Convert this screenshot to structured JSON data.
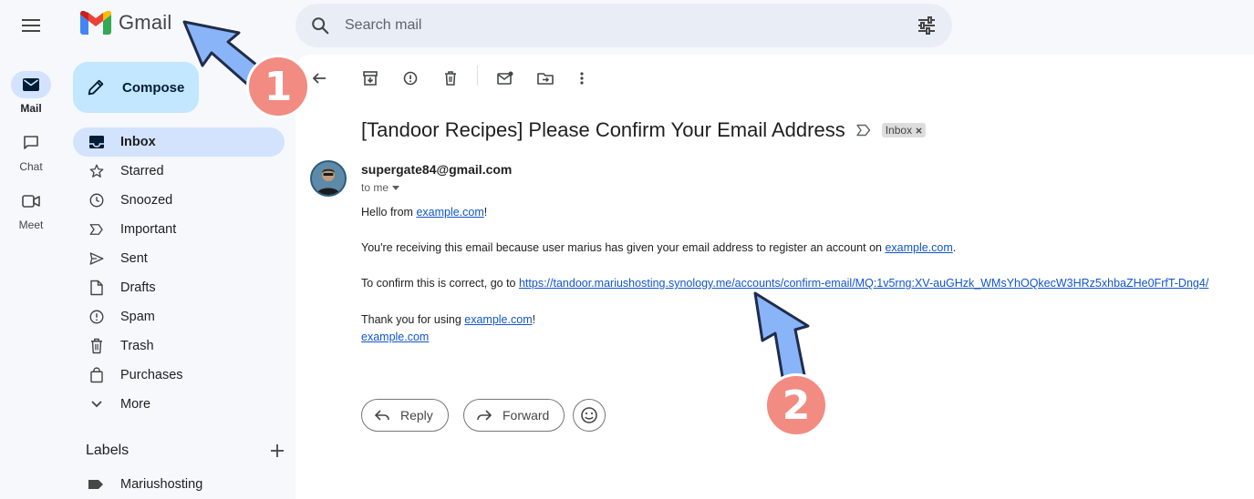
{
  "app": {
    "name": "Gmail"
  },
  "search": {
    "placeholder": "Search mail"
  },
  "rail": [
    {
      "label": "Mail"
    },
    {
      "label": "Chat"
    },
    {
      "label": "Meet"
    }
  ],
  "compose": {
    "label": "Compose"
  },
  "nav": [
    {
      "label": "Inbox",
      "icon": "inbox-icon"
    },
    {
      "label": "Starred",
      "icon": "star-icon"
    },
    {
      "label": "Snoozed",
      "icon": "clock-icon"
    },
    {
      "label": "Important",
      "icon": "important-icon"
    },
    {
      "label": "Sent",
      "icon": "send-icon"
    },
    {
      "label": "Drafts",
      "icon": "draft-icon"
    },
    {
      "label": "Spam",
      "icon": "spam-icon"
    },
    {
      "label": "Trash",
      "icon": "trash-icon"
    },
    {
      "label": "Purchases",
      "icon": "shopping-bag-icon"
    },
    {
      "label": "More",
      "icon": "chevron-down-icon"
    }
  ],
  "labels": {
    "title": "Labels",
    "items": [
      {
        "label": "Mariushosting"
      }
    ]
  },
  "email": {
    "subject": "[Tandoor Recipes] Please Confirm Your Email Address",
    "badge": "Inbox",
    "sender": "supergate84@gmail.com",
    "to": "to me",
    "greeting_prefix": "Hello from ",
    "greeting_link": "example.com",
    "greeting_suffix": "!",
    "line2_prefix": "You're receiving this email because user marius has given your email address to register an account on ",
    "line2_link": "example.com",
    "line2_suffix": ".",
    "line3_prefix": "To confirm this is correct, go to ",
    "line3_link": "https://tandoor.mariushosting.synology.me/accounts/confirm-email/MQ:1v5rng:XV-auGHzk_WMsYhOQkecW3HRz5xhbaZHe0FrfT-Dng4/",
    "line4_prefix": "Thank you for using ",
    "line4_link": "example.com",
    "line4_suffix": "!",
    "signature_link": "example.com"
  },
  "actions": {
    "reply": "Reply",
    "forward": "Forward"
  },
  "annotations": [
    {
      "number": "1"
    },
    {
      "number": "2"
    }
  ],
  "colors": {
    "accent": "#c2e7ff",
    "selected": "#d3e3fd",
    "annotation_fill": "#f28b82",
    "arrow_fill": "#8ab4f8"
  }
}
